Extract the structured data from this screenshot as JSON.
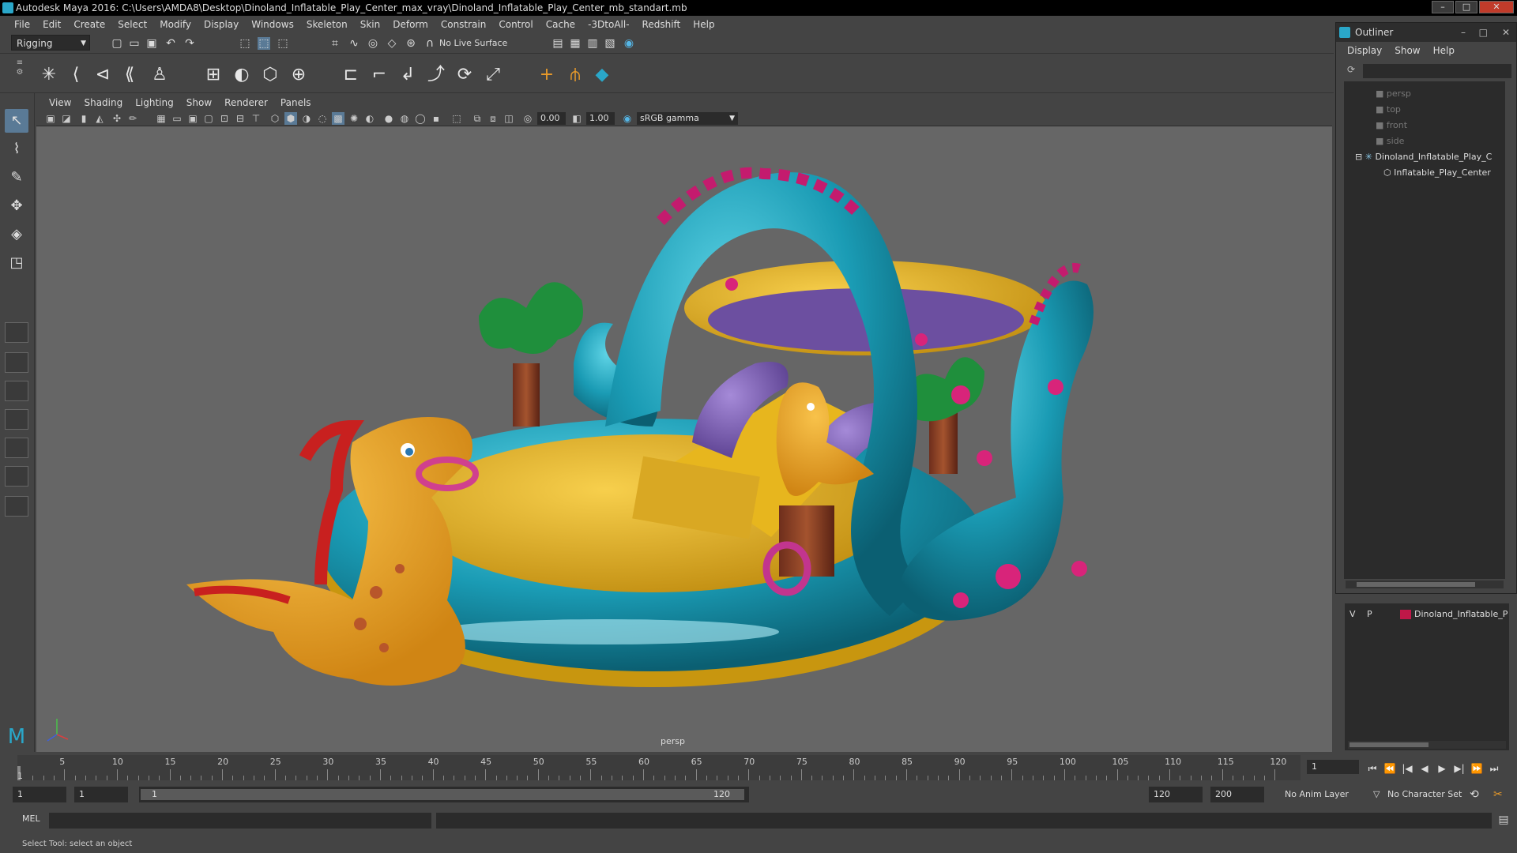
{
  "window": {
    "title": "Autodesk Maya 2016: C:\\Users\\AMDA8\\Desktop\\Dinoland_Inflatable_Play_Center_max_vray\\Dinoland_Inflatable_Play_Center_mb_standart.mb"
  },
  "menubar": [
    "File",
    "Edit",
    "Create",
    "Select",
    "Modify",
    "Display",
    "Windows",
    "Skeleton",
    "Skin",
    "Deform",
    "Constrain",
    "Control",
    "Cache",
    "-3DtoAll-",
    "Redshift",
    "Help"
  ],
  "statusline": {
    "menuset": "Rigging",
    "live_surface": "No Live Surface"
  },
  "viewport": {
    "menu": [
      "View",
      "Shading",
      "Lighting",
      "Show",
      "Renderer",
      "Panels"
    ],
    "exposure": "0.00",
    "gamma": "1.00",
    "color_space": "sRGB gamma",
    "camera_label": "persp"
  },
  "outliner": {
    "title": "Outliner",
    "menu": [
      "Display",
      "Show",
      "Help"
    ],
    "items": [
      {
        "label": "persp",
        "dim": true
      },
      {
        "label": "top",
        "dim": true
      },
      {
        "label": "front",
        "dim": true
      },
      {
        "label": "side",
        "dim": true
      },
      {
        "label": "Dinoland_Inflatable_Play_C",
        "dim": false
      },
      {
        "label": "Inflatable_Play_Center",
        "dim": false
      }
    ]
  },
  "layers": {
    "visible": "V",
    "playback": "P",
    "name": "Dinoland_Inflatable_P",
    "color": "#c01848"
  },
  "timeslider": {
    "ticks": [
      "5",
      "10",
      "15",
      "20",
      "25",
      "30",
      "35",
      "40",
      "45",
      "50",
      "55",
      "60",
      "65",
      "70",
      "75",
      "80",
      "85",
      "90",
      "95",
      "100",
      "105",
      "110",
      "115",
      "120"
    ],
    "start_marker": "1",
    "current_frame": "1"
  },
  "rangeslider": {
    "start": "1",
    "anim_start": "1",
    "range_start": "1",
    "range_end": "120",
    "end": "120",
    "anim_end": "200",
    "anim_layer": "No Anim Layer",
    "character_set": "No Character Set"
  },
  "cmdline": {
    "label": "MEL"
  },
  "helpline": {
    "text": "Select Tool: select an object"
  }
}
